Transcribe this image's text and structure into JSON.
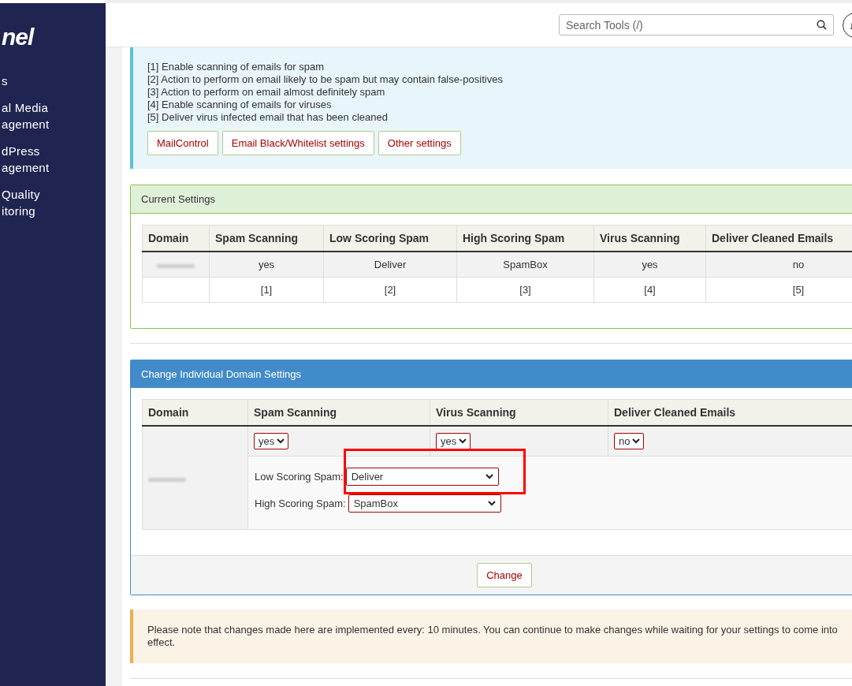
{
  "sidebar": {
    "logo": "nel",
    "items": [
      {
        "lines": [
          "s"
        ]
      },
      {
        "lines": [
          "al Media",
          "agement"
        ]
      },
      {
        "lines": [
          "dPress",
          "agement"
        ]
      },
      {
        "lines": [
          "Quality",
          "itoring"
        ]
      }
    ]
  },
  "header": {
    "search": {
      "placeholder": "Search Tools (/)"
    }
  },
  "legend": {
    "lines": [
      "[1] Enable scanning of emails for spam",
      "[2] Action to perform on email likely to be spam but may contain false-positives",
      "[3] Action to perform on email almost definitely spam",
      "[4] Enable scanning of emails for viruses",
      "[5] Deliver virus infected email that has been cleaned"
    ],
    "buttons": [
      "MailControl",
      "Email Black/Whitelist settings",
      "Other settings"
    ]
  },
  "current_settings": {
    "title": "Current Settings",
    "columns": [
      "Domain",
      "Spam Scanning",
      "Low Scoring Spam",
      "High Scoring Spam",
      "Virus Scanning",
      "Deliver Cleaned Emails"
    ],
    "rows": [
      {
        "cells": [
          "",
          "yes",
          "Deliver",
          "SpamBox",
          "yes",
          "no"
        ]
      },
      {
        "cells": [
          "",
          "[1]",
          "[2]",
          "[3]",
          "[4]",
          "[5]"
        ]
      }
    ]
  },
  "change_settings": {
    "title": "Change Individual Domain Settings",
    "columns": [
      "Domain",
      "Spam Scanning",
      "Virus Scanning",
      "Deliver Cleaned Emails"
    ],
    "selects": [
      "yes",
      "yes",
      "no"
    ],
    "spam_fields": [
      {
        "label": "Low Scoring Spam:",
        "value": "Deliver"
      },
      {
        "label": "High Scoring Spam:",
        "value": "SpamBox"
      }
    ],
    "annotation": {
      "kind": "box"
    },
    "button": "Change"
  },
  "note": "Please note that changes made here are implemented every: 10 minutes. You can continue to make changes while waiting for your settings to come into effect."
}
